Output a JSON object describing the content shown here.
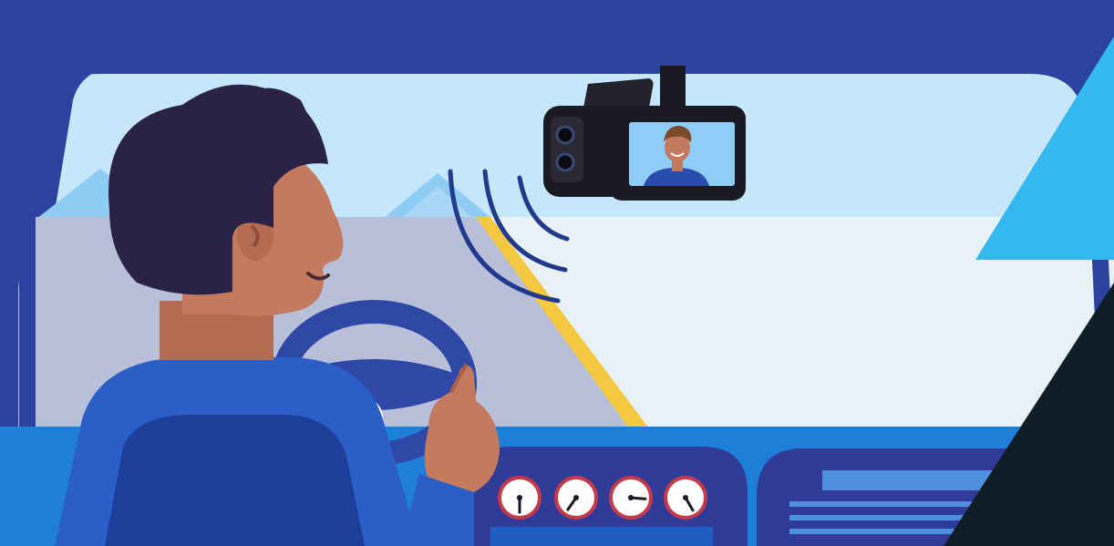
{
  "scene": {
    "description_tag": "driver-with-dash-camera-illustration"
  },
  "palette": {
    "car_frame": "#2c42a0",
    "sky": "#c5e6fb",
    "mountains": "#8fccf3",
    "road_left": "#b8bfd9",
    "road_right": "#e8f0f8",
    "road_line": "#f5c842",
    "dashboard": "#1e7fd8",
    "console": "#2f3b97",
    "driver_hair": "#2b2347",
    "driver_skin": "#c47a5e",
    "seat_outer": "#2b5fc7",
    "seat_inner": "#1d3f9a",
    "wheel": "#3048a5",
    "camera_body": "#1a1a22",
    "camera_screen": "#8ecdf5",
    "signal_waves": "#233a8c",
    "gauge_face": "#ffffff",
    "gauge_rim": "#c33a4a",
    "accent_triangle": "#35b8f0",
    "dark_panel": "#0f1e26"
  },
  "gauges": [
    {
      "needle_angle": 180
    },
    {
      "needle_angle": 215
    },
    {
      "needle_angle": 95
    },
    {
      "needle_angle": 150
    }
  ]
}
